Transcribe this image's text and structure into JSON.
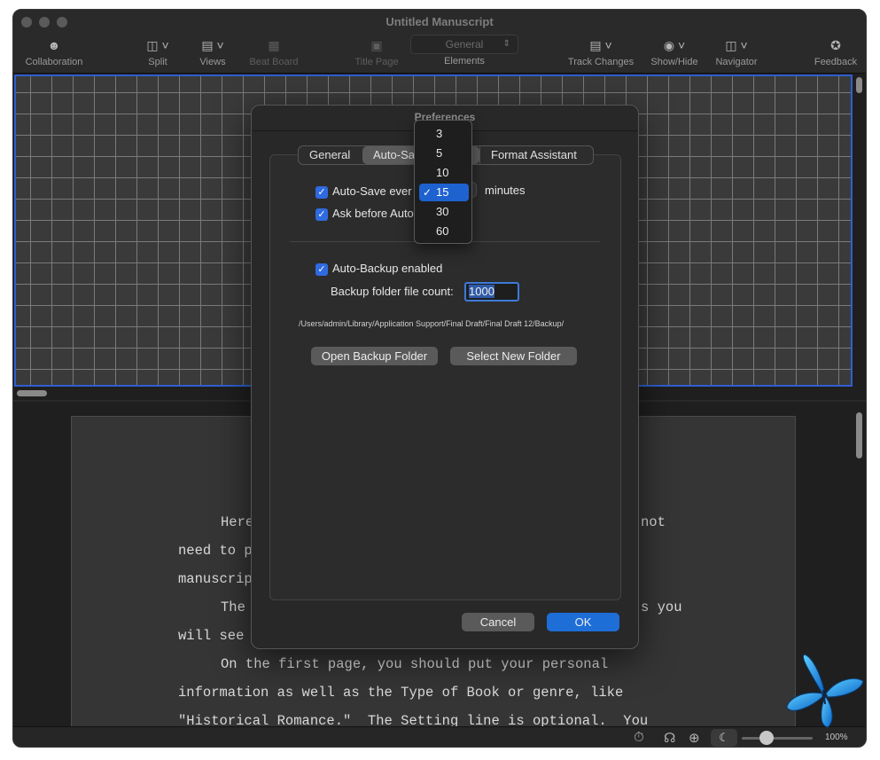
{
  "window": {
    "title": "Untitled Manuscript"
  },
  "toolbar": {
    "collaboration": "Collaboration",
    "split": "Split",
    "views": "Views",
    "beat_board": "Beat Board",
    "title_page": "Title Page",
    "elements_label": "Elements",
    "elements_value": "General",
    "track_changes": "Track Changes",
    "show_hide": "Show/Hide",
    "navigator": "Navigator",
    "feedback": "Feedback"
  },
  "script_lines": [
    "Here",
    "not",
    "need to p",
    "manuscrip",
    "The",
    "s you",
    "will see",
    "On the first page, you should put your personal",
    "information as well as the Type of Book or genre, like",
    "\"Historical Romance.\"  The Setting line is optional.  You"
  ],
  "statusbar": {
    "zoom": "100%"
  },
  "preferences": {
    "title": "Preferences",
    "tabs": [
      {
        "label": "General"
      },
      {
        "label": "Auto-Sa"
      },
      {
        "label": "Format Assistant"
      }
    ],
    "autosave_label": "Auto-Save ever",
    "minutes_label": "minutes",
    "ask_before_label": "Ask before Auto",
    "autobackup_label": "Auto-Backup enabled",
    "backup_count_label": "Backup folder file count:",
    "backup_count_value": "1000",
    "backup_path": "/Users/admin/Library/Application Support/Final Draft/Final Draft 12/Backup/",
    "open_backup_button": "Open Backup Folder",
    "select_folder_button": "Select New Folder",
    "cancel_button": "Cancel",
    "ok_button": "OK"
  },
  "interval_menu": {
    "options": [
      "3",
      "5",
      "10",
      "15",
      "30",
      "60"
    ],
    "selected": "15"
  }
}
